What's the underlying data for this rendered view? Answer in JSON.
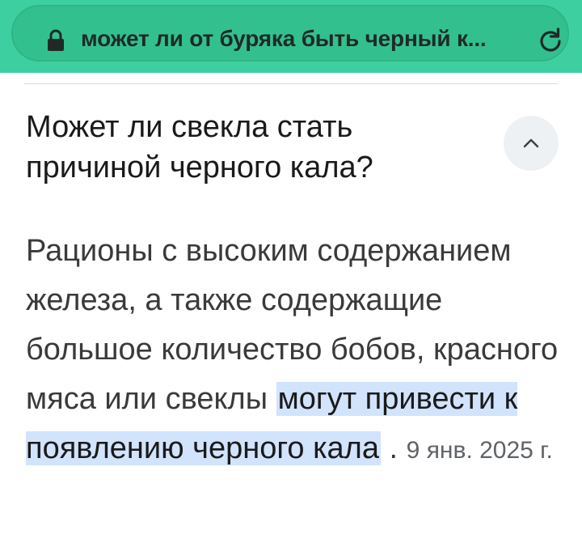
{
  "address_bar": {
    "url_text": "может ли от буряка быть черный к...",
    "lock_icon": "lock-icon",
    "reload_icon": "reload-icon",
    "bar_color": "#3ecfa0"
  },
  "faq": {
    "question": "Может ли свекла стать причиной черного кала?",
    "collapse_icon": "chevron-up-icon",
    "answer_text": "Рационы с высоким содержанием железа, а также содержащие большое количество бобов, красного мяса или свеклы ",
    "answer_highlight": "могут привести к появлению черного кала",
    "answer_separator": " . ",
    "answer_date": "9 янв. 2025 г.",
    "highlight_color": "#d2e3fc"
  }
}
